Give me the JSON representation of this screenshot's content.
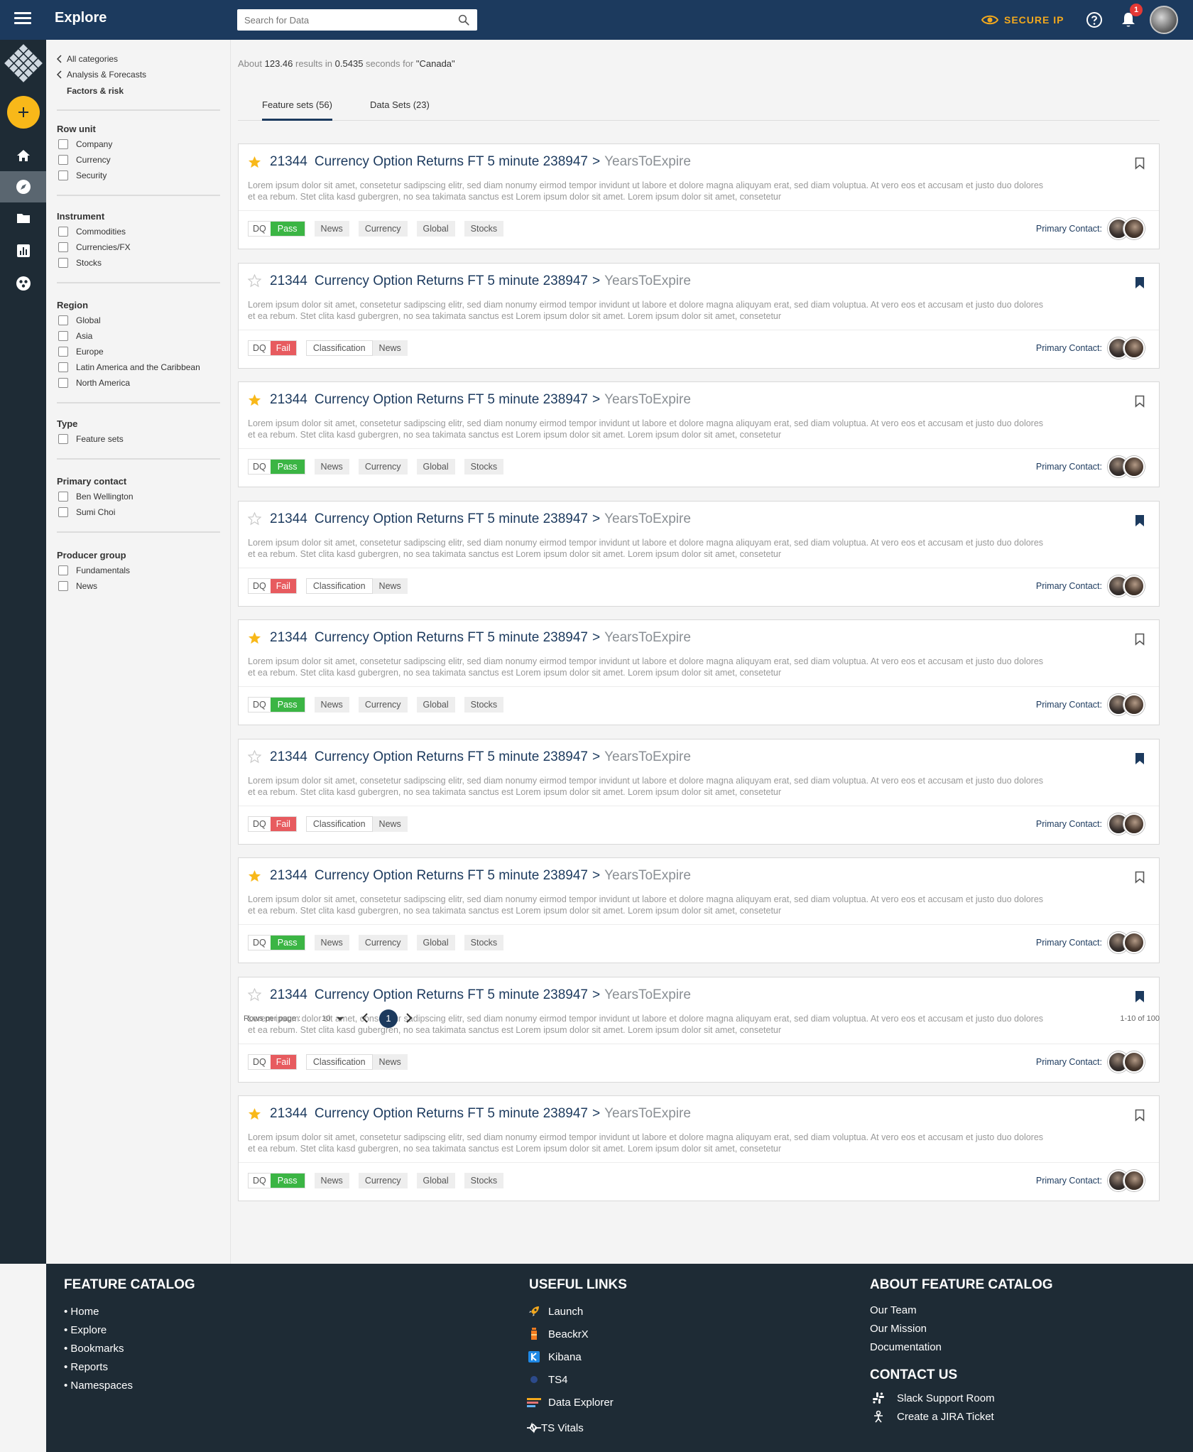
{
  "header": {
    "menu_icon": "menu-icon",
    "title": "Explore",
    "search_placeholder": "Search for Data",
    "search_icon": "search-icon",
    "secure_label": "SECURE IP",
    "secure_icon": "eye-icon",
    "help_icon": "help-icon",
    "notifications_icon": "bell-icon",
    "notification_count": "1"
  },
  "rail": {
    "logo": "diamond-logo",
    "add_icon": "plus-icon",
    "items": [
      "home-icon",
      "compass-icon",
      "folder-icon",
      "chart-icon",
      "namespace-icon"
    ],
    "active_index": 1
  },
  "facets": {
    "breadcrumbs": [
      "All categories",
      "Analysis & Forecasts"
    ],
    "current_category": "Factors & risk",
    "groups": [
      {
        "title": "Row unit",
        "options": [
          "Company",
          "Currency",
          "Security"
        ]
      },
      {
        "title": "Instrument",
        "options": [
          "Commodities",
          "Currencies/FX",
          "Stocks"
        ]
      },
      {
        "title": "Region",
        "options": [
          "Global",
          "Asia",
          "Europe",
          "Latin America and the Caribbean",
          "North America"
        ]
      },
      {
        "title": "Type",
        "options": [
          "Feature sets"
        ]
      },
      {
        "title": "Primary contact",
        "options": [
          "Ben Wellington",
          "Sumi Choi"
        ]
      },
      {
        "title": "Producer group",
        "options": [
          "Fundamentals",
          "News"
        ]
      }
    ]
  },
  "results": {
    "prefix": "About",
    "count": "123.46",
    "mid": "results in",
    "seconds": "0.5435",
    "suffix": "seconds for",
    "query": "\"Canada\""
  },
  "tabs": [
    {
      "label": "Feature sets (56)",
      "active": true
    },
    {
      "label": "Data Sets (23)",
      "active": false
    }
  ],
  "cards": [
    {
      "starred": true,
      "bookmarked": false,
      "id": "21344",
      "name": "Currency Option Returns FT 5 minute 238947",
      "sep": ">",
      "attribute": "YearsToExpire",
      "desc": "Lorem ipsum dolor sit amet, consetetur sadipscing elitr, sed diam nonumy eirmod tempor invidunt ut labore et dolore magna aliquyam erat, sed diam voluptua. At vero eos et accusam et justo duo dolores et ea rebum. Stet clita kasd gubergren, no sea takimata sanctus est Lorem ipsum dolor sit amet. Lorem ipsum dolor sit amet, consetetur",
      "dq_label": "DQ",
      "dq": "Pass",
      "tags": [
        "News",
        "Currency",
        "Global",
        "Stocks"
      ],
      "contact_label": "Primary Contact:"
    },
    {
      "starred": false,
      "bookmarked": true,
      "id": "21344",
      "name": "Currency Option Returns FT 5 minute 238947",
      "sep": ">",
      "attribute": "YearsToExpire",
      "desc": "Lorem ipsum dolor sit amet, consetetur sadipscing elitr, sed diam nonumy eirmod tempor invidunt ut labore et dolore magna aliquyam erat, sed diam voluptua. At vero eos et accusam et justo duo dolores et ea rebum. Stet clita kasd gubergren, no sea takimata sanctus est Lorem ipsum dolor sit amet. Lorem ipsum dolor sit amet, consetetur",
      "dq_label": "DQ",
      "dq": "Fail",
      "tags": [
        "Classification",
        "News"
      ],
      "contact_label": "Primary Contact:"
    },
    {
      "starred": true,
      "bookmarked": false,
      "id": "21344",
      "name": "Currency Option Returns FT 5 minute 238947",
      "sep": ">",
      "attribute": "YearsToExpire",
      "desc": "Lorem ipsum dolor sit amet, consetetur sadipscing elitr, sed diam nonumy eirmod tempor invidunt ut labore et dolore magna aliquyam erat, sed diam voluptua. At vero eos et accusam et justo duo dolores et ea rebum. Stet clita kasd gubergren, no sea takimata sanctus est Lorem ipsum dolor sit amet. Lorem ipsum dolor sit amet, consetetur",
      "dq_label": "DQ",
      "dq": "Pass",
      "tags": [
        "News",
        "Currency",
        "Global",
        "Stocks"
      ],
      "contact_label": "Primary Contact:"
    },
    {
      "starred": false,
      "bookmarked": true,
      "id": "21344",
      "name": "Currency Option Returns FT 5 minute 238947",
      "sep": ">",
      "attribute": "YearsToExpire",
      "desc": "Lorem ipsum dolor sit amet, consetetur sadipscing elitr, sed diam nonumy eirmod tempor invidunt ut labore et dolore magna aliquyam erat, sed diam voluptua. At vero eos et accusam et justo duo dolores et ea rebum. Stet clita kasd gubergren, no sea takimata sanctus est Lorem ipsum dolor sit amet. Lorem ipsum dolor sit amet, consetetur",
      "dq_label": "DQ",
      "dq": "Fail",
      "tags": [
        "Classification",
        "News"
      ],
      "contact_label": "Primary Contact:"
    },
    {
      "starred": true,
      "bookmarked": false,
      "id": "21344",
      "name": "Currency Option Returns FT 5 minute 238947",
      "sep": ">",
      "attribute": "YearsToExpire",
      "desc": "Lorem ipsum dolor sit amet, consetetur sadipscing elitr, sed diam nonumy eirmod tempor invidunt ut labore et dolore magna aliquyam erat, sed diam voluptua. At vero eos et accusam et justo duo dolores et ea rebum. Stet clita kasd gubergren, no sea takimata sanctus est Lorem ipsum dolor sit amet. Lorem ipsum dolor sit amet, consetetur",
      "dq_label": "DQ",
      "dq": "Pass",
      "tags": [
        "News",
        "Currency",
        "Global",
        "Stocks"
      ],
      "contact_label": "Primary Contact:"
    },
    {
      "starred": false,
      "bookmarked": true,
      "id": "21344",
      "name": "Currency Option Returns FT 5 minute 238947",
      "sep": ">",
      "attribute": "YearsToExpire",
      "desc": "Lorem ipsum dolor sit amet, consetetur sadipscing elitr, sed diam nonumy eirmod tempor invidunt ut labore et dolore magna aliquyam erat, sed diam voluptua. At vero eos et accusam et justo duo dolores et ea rebum. Stet clita kasd gubergren, no sea takimata sanctus est Lorem ipsum dolor sit amet. Lorem ipsum dolor sit amet, consetetur",
      "dq_label": "DQ",
      "dq": "Fail",
      "tags": [
        "Classification",
        "News"
      ],
      "contact_label": "Primary Contact:"
    },
    {
      "starred": true,
      "bookmarked": false,
      "id": "21344",
      "name": "Currency Option Returns FT 5 minute 238947",
      "sep": ">",
      "attribute": "YearsToExpire",
      "desc": "Lorem ipsum dolor sit amet, consetetur sadipscing elitr, sed diam nonumy eirmod tempor invidunt ut labore et dolore magna aliquyam erat, sed diam voluptua. At vero eos et accusam et justo duo dolores et ea rebum. Stet clita kasd gubergren, no sea takimata sanctus est Lorem ipsum dolor sit amet. Lorem ipsum dolor sit amet, consetetur",
      "dq_label": "DQ",
      "dq": "Pass",
      "tags": [
        "News",
        "Currency",
        "Global",
        "Stocks"
      ],
      "contact_label": "Primary Contact:"
    },
    {
      "starred": false,
      "bookmarked": true,
      "id": "21344",
      "name": "Currency Option Returns FT 5 minute 238947",
      "sep": ">",
      "attribute": "YearsToExpire",
      "desc": "Lorem ipsum dolor sit amet, consetetur sadipscing elitr, sed diam nonumy eirmod tempor invidunt ut labore et dolore magna aliquyam erat, sed diam voluptua. At vero eos et accusam et justo duo dolores et ea rebum. Stet clita kasd gubergren, no sea takimata sanctus est Lorem ipsum dolor sit amet. Lorem ipsum dolor sit amet, consetetur",
      "dq_label": "DQ",
      "dq": "Fail",
      "tags": [
        "Classification",
        "News"
      ],
      "contact_label": "Primary Contact:"
    },
    {
      "starred": true,
      "bookmarked": false,
      "id": "21344",
      "name": "Currency Option Returns FT 5 minute 238947",
      "sep": ">",
      "attribute": "YearsToExpire",
      "desc": "Lorem ipsum dolor sit amet, consetetur sadipscing elitr, sed diam nonumy eirmod tempor invidunt ut labore et dolore magna aliquyam erat, sed diam voluptua. At vero eos et accusam et justo duo dolores et ea rebum. Stet clita kasd gubergren, no sea takimata sanctus est Lorem ipsum dolor sit amet. Lorem ipsum dolor sit amet, consetetur",
      "dq_label": "DQ",
      "dq": "Pass",
      "tags": [
        "News",
        "Currency",
        "Global",
        "Stocks"
      ],
      "contact_label": "Primary Contact:"
    }
  ],
  "pagination": {
    "rows_label": "Rows per page :",
    "rows_value": "10",
    "current_page": "1",
    "range": "1-10 of 100"
  },
  "footer": {
    "catalog": {
      "title": "FEATURE CATALOG",
      "links": [
        "• Home",
        "• Explore",
        "• Bookmarks",
        "• Reports",
        "• Namespaces"
      ]
    },
    "useful": {
      "title": "USEFUL LINKS",
      "links": [
        {
          "label": "Launch",
          "icon": "rocket-icon"
        },
        {
          "label": "BeackrX",
          "icon": "beaker-icon"
        },
        {
          "label": "Kibana",
          "icon": "kibana-icon"
        },
        {
          "label": "TS4",
          "icon": "ts4-icon"
        },
        {
          "label": "Data Explorer",
          "icon": "data-explorer-icon"
        },
        {
          "label": "TS Vitals",
          "icon": "vitals-icon"
        }
      ]
    },
    "about": {
      "title": "ABOUT FEATURE CATALOG",
      "links": [
        "Our Team",
        "Our Mission",
        "Documentation"
      ]
    },
    "contact": {
      "title": "CONTACT US",
      "links": [
        {
          "label": "Slack Support Room",
          "icon": "slack-icon"
        },
        {
          "label": "Create a JIRA Ticket",
          "icon": "jira-icon"
        }
      ]
    }
  },
  "colors": {
    "header_bg": "#1c3a5e",
    "rail_bg": "#1e2b35",
    "accent": "#f8b819",
    "pass": "#3bb544",
    "fail": "#e75b5f",
    "link": "#1c3a5e"
  }
}
